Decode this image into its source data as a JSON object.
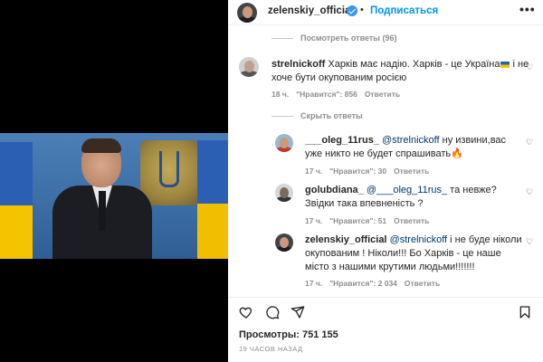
{
  "header": {
    "username": "zelenskiy_official",
    "dot": "•",
    "follow_label": "Подписаться",
    "more": "•••"
  },
  "thread": {
    "view_replies_label": "Посмотреть ответы (96)",
    "hide_replies_label": "Скрыть ответы"
  },
  "comments": [
    {
      "username": "strelnickoff",
      "text": "Харків має надію. Харків - це Україна",
      "text_after_flag": " і не хоче бути окупованим росією",
      "time": "18 ч.",
      "likes": "\"Нравится\": 856",
      "reply_label": "Ответить"
    },
    {
      "username": "___oleg_11rus_",
      "mention": "@strelnickoff",
      "text": " ну извини,вас уже никто не будет спрашивать",
      "emoji": "🔥",
      "time": "17 ч.",
      "likes": "\"Нравится\": 30",
      "reply_label": "Ответить"
    },
    {
      "username": "golubdiana_",
      "mention": "@___oleg_11rus_",
      "text": " та невже? Звідки така впевненість ?",
      "time": "17 ч.",
      "likes": "\"Нравится\": 51",
      "reply_label": "Ответить"
    },
    {
      "username": "zelenskiy_official",
      "mention": "@strelnickoff",
      "text": " і не буде ніколи окупованим ! Ніколи!!! Бо Харків - це наше місто з нашими крутими людьми!!!!!!!",
      "time": "17 ч.",
      "likes": "\"Нравится\": 2 034",
      "reply_label": "Ответить"
    }
  ],
  "footer": {
    "views": "Просмотры: 751 155",
    "posted": "19 ЧАСОВ НАЗАД"
  },
  "colors": {
    "accent": "#0095f6",
    "verified": "#3897f0",
    "muted": "#8e8e8e",
    "text": "#262626"
  }
}
